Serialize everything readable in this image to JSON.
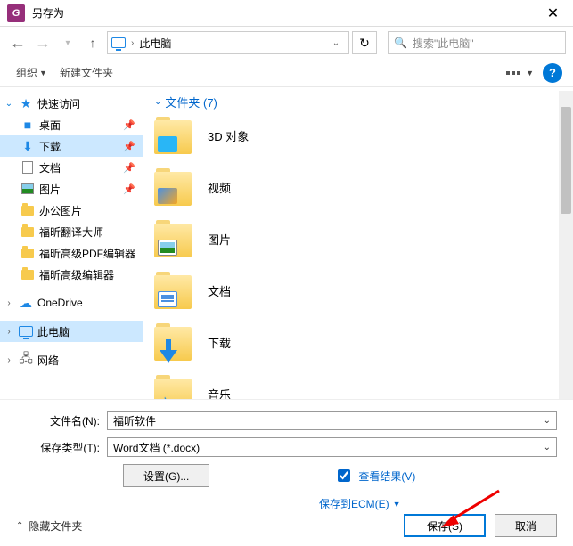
{
  "title": "另存为",
  "nav": {
    "location": "此电脑",
    "search_placeholder": "搜索\"此电脑\""
  },
  "toolbar": {
    "organize": "组织",
    "new_folder": "新建文件夹"
  },
  "sidebar": {
    "quick_access": "快速访问",
    "items": [
      {
        "label": "桌面",
        "icon": "desktop",
        "pinned": true
      },
      {
        "label": "下载",
        "icon": "download",
        "pinned": true,
        "selected": true
      },
      {
        "label": "文档",
        "icon": "document",
        "pinned": true
      },
      {
        "label": "图片",
        "icon": "picture",
        "pinned": true
      },
      {
        "label": "办公图片",
        "icon": "folder",
        "pinned": false
      },
      {
        "label": "福昕翻译大师",
        "icon": "folder",
        "pinned": false
      },
      {
        "label": "福昕高级PDF编辑器",
        "icon": "folder",
        "pinned": false
      },
      {
        "label": "福昕高级编辑器",
        "icon": "folder",
        "pinned": false
      }
    ],
    "onedrive": "OneDrive",
    "this_pc": "此电脑",
    "network": "网络"
  },
  "content": {
    "section_label": "文件夹 (7)",
    "folders": [
      {
        "label": "3D 对象",
        "badge": "obj3d"
      },
      {
        "label": "视频",
        "badge": "video"
      },
      {
        "label": "图片",
        "badge": "pic"
      },
      {
        "label": "文档",
        "badge": "doc"
      },
      {
        "label": "下载",
        "badge": "dl"
      },
      {
        "label": "音乐",
        "badge": "music"
      }
    ]
  },
  "form": {
    "filename_label": "文件名(N):",
    "filename_value": "福昕软件",
    "filetype_label": "保存类型(T):",
    "filetype_value": "Word文档 (*.docx)",
    "settings_btn": "设置(G)...",
    "view_result": "查看结果(V)",
    "save_to_ecm": "保存到ECM(E)"
  },
  "bottom": {
    "hide_folders": "隐藏文件夹",
    "save": "保存(S)",
    "cancel": "取消"
  }
}
